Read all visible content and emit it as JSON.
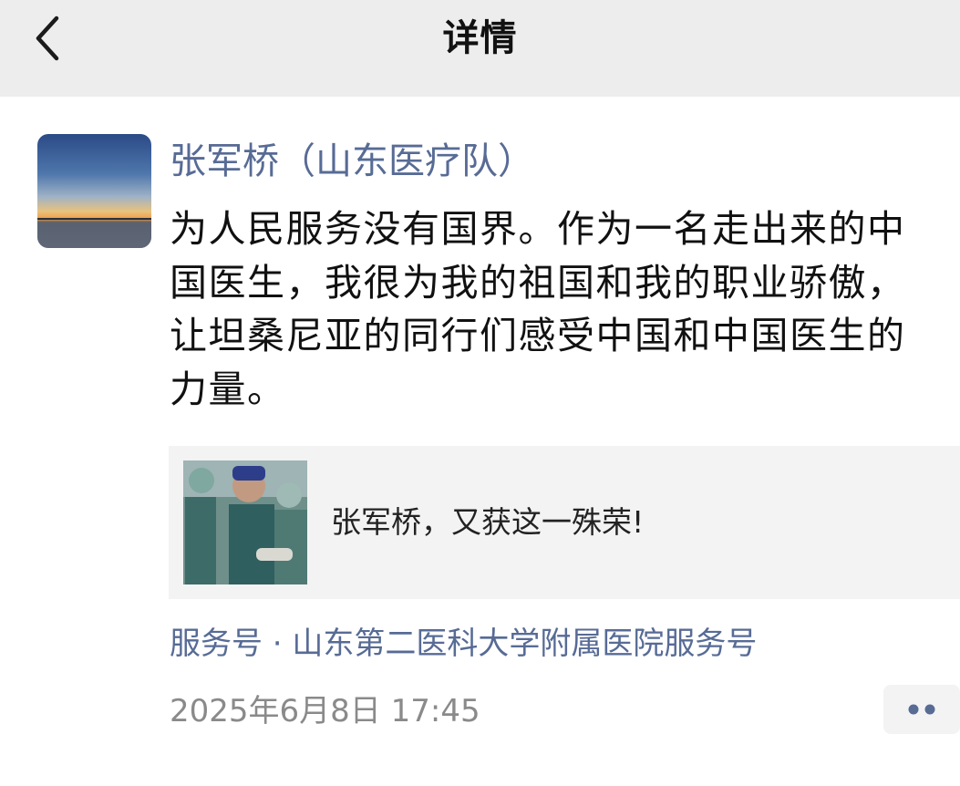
{
  "header": {
    "title": "详情",
    "back_icon": "chevron-left-icon"
  },
  "post": {
    "author": "张军桥（山东医疗队）",
    "text": "为人民服务没有国界。作为一名走出来的中国医生，我很为我的祖国和我的职业骄傲，让坦桑尼亚的同行们感受中国和中国医生的力量。",
    "avatar_icon": "sunset-avatar",
    "link_card": {
      "title": "张军桥，又获这一殊荣!",
      "thumbnail_icon": "surgeons-photo"
    },
    "source": "服务号 · 山东第二医科大学附属医院服务号",
    "timestamp": "2025年6月8日 17:45",
    "more_icon": "more-dots-icon"
  },
  "colors": {
    "header_bg": "#ededed",
    "link_blue": "#576b95",
    "card_bg": "#f3f3f3",
    "meta_gray": "#8a8a8a",
    "text": "#111111"
  }
}
